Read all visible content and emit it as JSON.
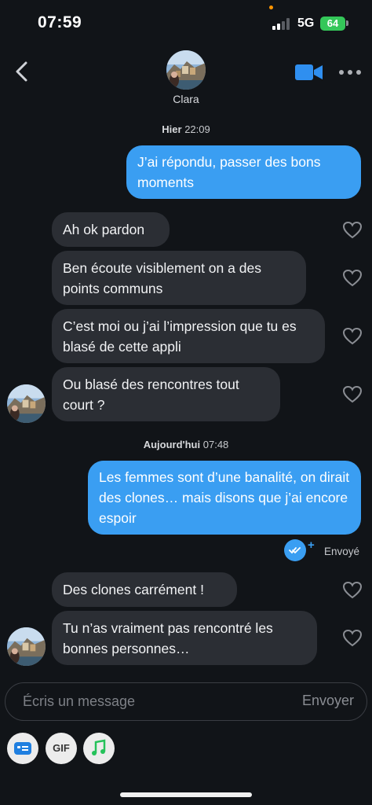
{
  "status_bar": {
    "time": "07:59",
    "network": "5G",
    "battery": "64"
  },
  "header": {
    "contact_name": "Clara"
  },
  "timestamps": [
    {
      "day": "Hier",
      "time": "22:09"
    },
    {
      "day": "Aujourd'hui",
      "time": "07:48"
    }
  ],
  "messages": [
    {
      "direction": "out",
      "text": "J’ai répondu, passer des bons moments"
    },
    {
      "direction": "in",
      "text": "Ah ok pardon"
    },
    {
      "direction": "in",
      "text": "Ben écoute visiblement on a des points communs"
    },
    {
      "direction": "in",
      "text": "C’est moi ou j’ai l’impression que tu es blasé de cette appli"
    },
    {
      "direction": "in",
      "text": "Ou blasé des rencontres tout court ?"
    },
    {
      "direction": "out",
      "text": "Les femmes sont d’une banalité, on dirait des clones… mais disons que j’ai encore espoir"
    },
    {
      "direction": "in",
      "text": "Des clones carrément !"
    },
    {
      "direction": "in",
      "text": "Tu n’as vraiment pas rencontré les bonnes personnes…"
    }
  ],
  "receipt": {
    "status": "Envoyé"
  },
  "composer": {
    "placeholder": "Écris un message",
    "send_label": "Envoyer"
  },
  "tools": {
    "gif_label": "GIF"
  },
  "icons": [
    "back-icon",
    "video-call-icon",
    "more-icon",
    "heart-icon",
    "read-receipt-icon",
    "sticker-icon",
    "music-icon"
  ],
  "colors": {
    "accent": "#3a9ef2",
    "background": "#111418",
    "incoming_bubble": "#2b2e34",
    "battery": "#34c759"
  }
}
